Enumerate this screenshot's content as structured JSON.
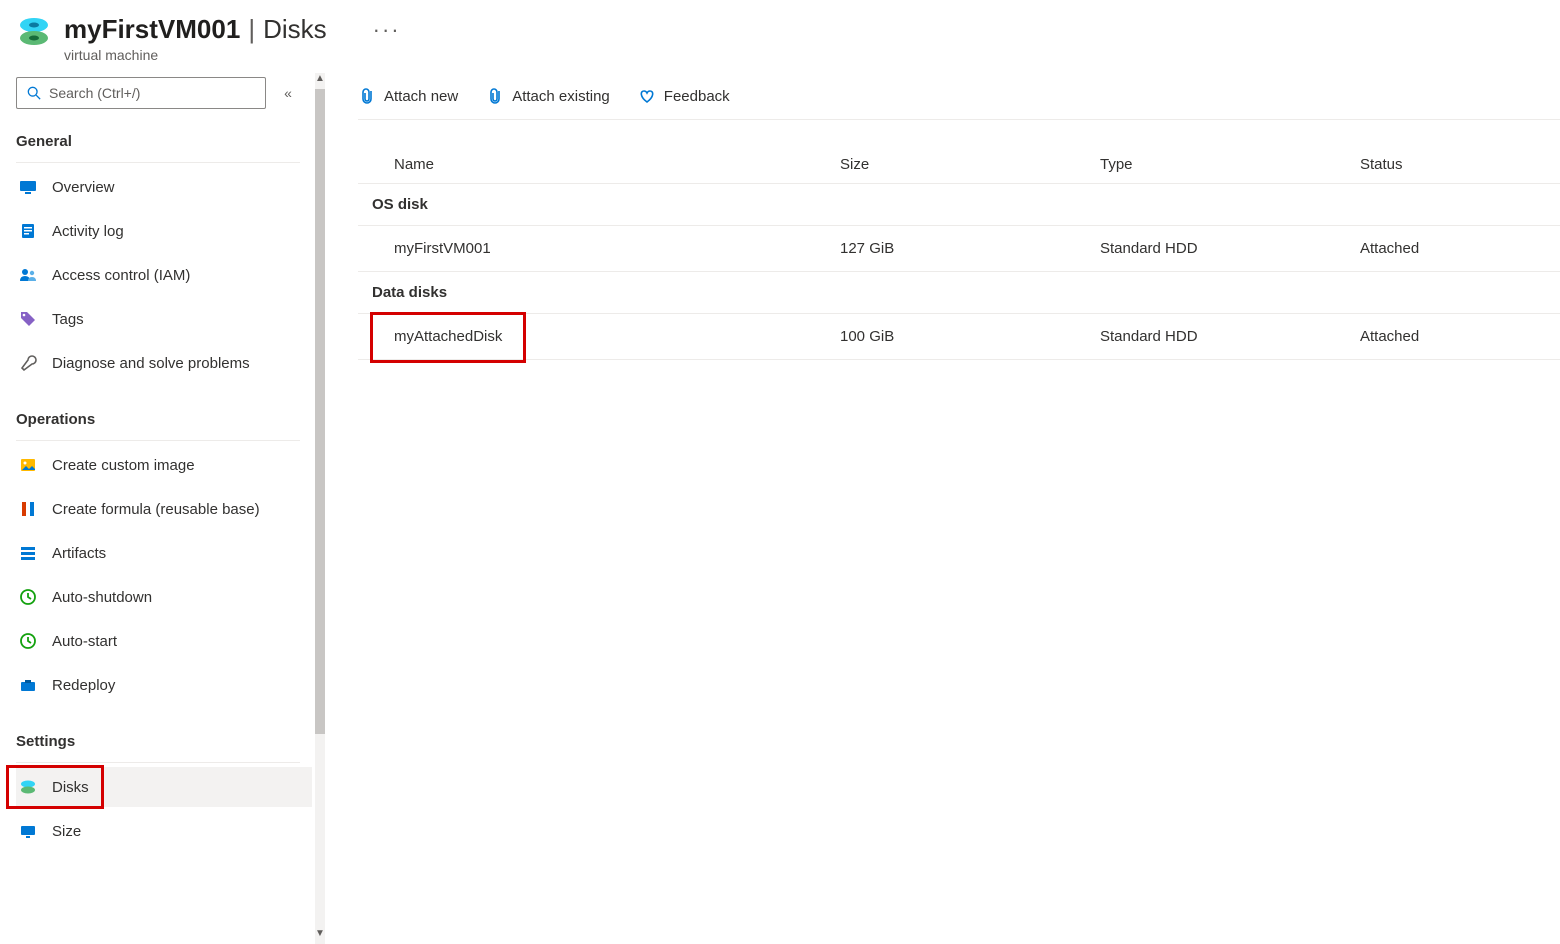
{
  "header": {
    "resource_name": "myFirstVM001",
    "separator": "|",
    "section": "Disks",
    "subtitle": "virtual machine",
    "more_label": "···"
  },
  "sidebar": {
    "search_placeholder": "Search (Ctrl+/)",
    "sections": {
      "general": {
        "title": "General",
        "items": [
          {
            "label": "Overview"
          },
          {
            "label": "Activity log"
          },
          {
            "label": "Access control (IAM)"
          },
          {
            "label": "Tags"
          },
          {
            "label": "Diagnose and solve problems"
          }
        ]
      },
      "operations": {
        "title": "Operations",
        "items": [
          {
            "label": "Create custom image"
          },
          {
            "label": "Create formula (reusable base)"
          },
          {
            "label": "Artifacts"
          },
          {
            "label": "Auto-shutdown"
          },
          {
            "label": "Auto-start"
          },
          {
            "label": "Redeploy"
          }
        ]
      },
      "settings": {
        "title": "Settings",
        "items": [
          {
            "label": "Disks"
          },
          {
            "label": "Size"
          }
        ]
      }
    }
  },
  "toolbar": {
    "attach_new": "Attach new",
    "attach_existing": "Attach existing",
    "feedback": "Feedback"
  },
  "table": {
    "columns": {
      "name": "Name",
      "size": "Size",
      "type": "Type",
      "status": "Status"
    },
    "groups": {
      "os": {
        "label": "OS disk",
        "rows": [
          {
            "name": "myFirstVM001",
            "size": "127 GiB",
            "type": "Standard HDD",
            "status": "Attached"
          }
        ]
      },
      "data": {
        "label": "Data disks",
        "rows": [
          {
            "name": "myAttachedDisk",
            "size": "100 GiB",
            "type": "Standard HDD",
            "status": "Attached"
          }
        ]
      }
    }
  }
}
